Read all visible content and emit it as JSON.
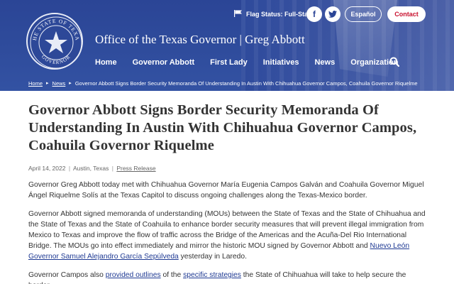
{
  "header": {
    "office_title": "Office of the Texas Governor | Greg Abbott",
    "flag_status": "Flag Status: Full-Staff",
    "espanol": "Español",
    "contact": "Contact"
  },
  "nav": {
    "items": [
      "Home",
      "Governor Abbott",
      "First Lady",
      "Initiatives",
      "News",
      "Organization"
    ]
  },
  "breadcrumb": {
    "home": "Home",
    "news": "News",
    "current": "Governor Abbott Signs Border Security Memoranda Of Understanding In Austin With Chihuahua Governor Campos, Coahuila Governor Riquelme"
  },
  "article": {
    "headline": "Governor Abbott Signs Border Security Memoranda Of Understanding In Austin With Chihuahua Governor Campos, Coahuila Governor Riquelme",
    "date": "April 14, 2022",
    "location": "Austin, Texas",
    "type": "Press Release",
    "p1": "Governor Greg Abbott today met with Chihuahua Governor María Eugenia Campos Galván and Coahuila Governor Miguel Ángel Riquelme Solís at the Texas Capitol to discuss ongoing challenges along the Texas-Mexico border.",
    "p2": "Governor Abbott signed memoranda of understanding (MOUs) between the State of Texas and the State of Chihuahua and the State of Texas and the State of Coahuila to enhance border security measures that will prevent illegal immigration from Mexico to Texas and improve the flow of traffic across the Bridge of the Americas and the Acuña-Del Rio International Bridge. The MOUs go into effect immediately and mirror the historic MOU signed by Governor Abbott and",
    "p2_link": "Nuevo León Governor Samuel Alejandro García Sepúlveda",
    "p2_tail": " yesterday in Laredo.",
    "p3_a": "Governor Campos also ",
    "p3_link1": "provided outlines",
    "p3_b": " of the ",
    "p3_link2": "specific strategies",
    "p3_c": " the State of Chihuahua will take to help secure the border."
  },
  "colors": {
    "header_blue": "#2b4596",
    "contact_red": "#c8102e",
    "link_blue": "#1f3a93"
  },
  "icons": [
    "texas-seal-logo",
    "flag-icon",
    "facebook-icon",
    "twitter-icon",
    "search-icon",
    "chevron-right-icon"
  ]
}
